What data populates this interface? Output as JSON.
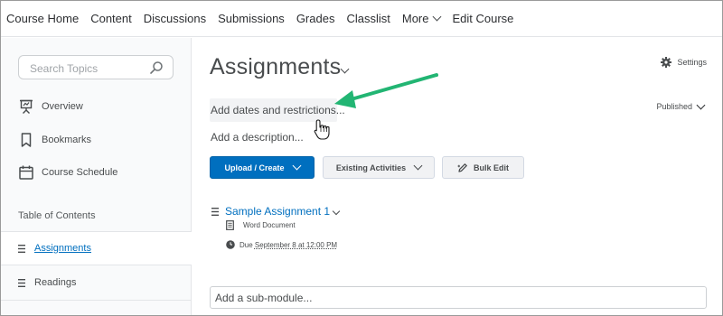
{
  "nav": {
    "items": [
      "Course Home",
      "Content",
      "Discussions",
      "Submissions",
      "Grades",
      "Classlist",
      "More",
      "Edit Course"
    ]
  },
  "sidebar": {
    "search_placeholder": "Search Topics",
    "items": [
      {
        "label": "Overview",
        "icon": "presentation-icon"
      },
      {
        "label": "Bookmarks",
        "icon": "bookmark-icon"
      },
      {
        "label": "Course Schedule",
        "icon": "calendar-icon"
      }
    ],
    "toc_title": "Table of Contents",
    "toc_items": [
      {
        "label": "Assignments",
        "active": true
      },
      {
        "label": "Readings",
        "active": false
      }
    ]
  },
  "main": {
    "title": "Assignments",
    "settings_label": "Settings",
    "dates_prompt": "Add dates and restrictions...",
    "published_label": "Published",
    "description_prompt": "Add a description...",
    "buttons": {
      "upload_create": "Upload / Create",
      "existing_activities": "Existing Activities",
      "bulk_edit": "Bulk Edit"
    },
    "assignment": {
      "title": "Sample Assignment 1",
      "type": "Word Document",
      "due_prefix": "Due",
      "due_date": "September 8 at 12:00 PM"
    },
    "submodule_prompt": "Add a sub-module..."
  },
  "colors": {
    "link": "#006fbf",
    "primary_button": "#006fbf",
    "annotation_arrow": "#22b573"
  }
}
